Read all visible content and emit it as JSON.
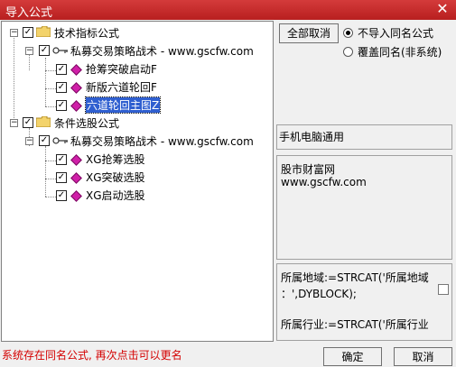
{
  "window": {
    "title": "导入公式",
    "close_glyph": "✕"
  },
  "tree": {
    "groups": [
      {
        "label": "技术指标公式",
        "child": {
          "label": "私募交易策略战术 - www.gscfw.com",
          "items": [
            "抢筹突破启动F",
            "新版六道轮回F",
            "六道轮回主图Z"
          ]
        }
      },
      {
        "label": "条件选股公式",
        "child": {
          "label": "私募交易策略战术 - www.gscfw.com",
          "items": [
            "XG抢筹选股",
            "XG突破选股",
            "XG启动选股"
          ]
        }
      }
    ],
    "selected_item": "六道轮回主图Z"
  },
  "options": {
    "cancel_all_label": "全部取消",
    "radio_no_import": "不导入同名公式",
    "radio_overwrite": "覆盖同名(非系统)"
  },
  "panels": {
    "usage": "手机电脑通用",
    "source_line1": "股市财富网",
    "source_line2": "www.gscfw.com",
    "code_line1": "所属地域:=STRCAT('所属地域",
    "code_line2": "：',DYBLOCK);",
    "code_line3": "所属行业:=STRCAT('所属行业"
  },
  "footer": {
    "status": "系统存在同名公式, 再次点击可以更名",
    "ok_label": "确定",
    "cancel_label": "取消"
  }
}
